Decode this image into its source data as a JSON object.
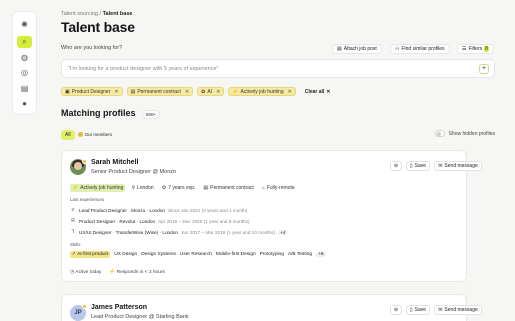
{
  "rail": {
    "items": [
      {
        "icon": "logo-icon",
        "glyph": "✺"
      },
      {
        "icon": "search-icon",
        "glyph": "⌕",
        "active": true
      },
      {
        "icon": "globe-icon",
        "glyph": "◍"
      },
      {
        "icon": "target-icon",
        "glyph": "◎"
      },
      {
        "icon": "document-icon",
        "glyph": "▤"
      },
      {
        "icon": "user-avatar-icon",
        "glyph": "●"
      }
    ]
  },
  "breadcrumb": {
    "parent": "Talent sourcing",
    "separator": "/",
    "current": "Talent base"
  },
  "page_title": "Talent base",
  "search": {
    "prompt": "Who are you looking for?",
    "placeholder": "\"I'm looking for a product designer with 5 years of experience\"",
    "add": "+"
  },
  "toolbar": {
    "attach": "Attach job post",
    "find_similar": "Find similar profiles",
    "filters": "Filters",
    "filters_count": "8"
  },
  "filters": [
    {
      "icon": "briefcase-icon",
      "glyph": "▣",
      "label": "Product Designer"
    },
    {
      "icon": "contract-icon",
      "glyph": "▤",
      "label": "Permanent contract"
    },
    {
      "icon": "brain-icon",
      "glyph": "✿",
      "label": "AI"
    },
    {
      "icon": "lightning-icon",
      "glyph": "⚡",
      "label": "Actively job hunting"
    }
  ],
  "clear_all": "Clear all",
  "matching": {
    "title": "Matching profiles",
    "count": "500+"
  },
  "segments": {
    "all": "All",
    "members": "Our members"
  },
  "hidden_toggle": "Show hidden profiles",
  "actions": {
    "save": "Save",
    "message": "Send message"
  },
  "profiles": [
    {
      "name": "Sarah Mitchell",
      "role": "Senior Product Designer @ Monzo",
      "tags": [
        {
          "icon": "lightning-icon",
          "glyph": "⚡",
          "label": "Actively job hunting"
        },
        {
          "icon": "location-icon",
          "glyph": "⚲",
          "label": "London"
        },
        {
          "icon": "experience-icon",
          "glyph": "⚙",
          "label": "7 years exp."
        },
        {
          "icon": "contract-icon",
          "glyph": "▤",
          "label": "Permanent contract"
        },
        {
          "icon": "remote-icon",
          "glyph": "⌂",
          "label": "Fully-remote"
        }
      ],
      "experience_label": "Last experiences",
      "experiences": [
        {
          "icon": "monzo-logo-icon",
          "glyph": "≡",
          "text": "Lead Product Designer · Monzo · London",
          "dates": "Since Jan 2021 (3 years and 1 month)"
        },
        {
          "icon": "revolut-logo-icon",
          "glyph": "R",
          "text": "Product Designer · Revolut · London",
          "dates": "Apr 2019 – Dec 2020 (1 year and 8 months)"
        },
        {
          "icon": "wise-logo-icon",
          "glyph": "⅂",
          "text": "UX/UI Designer · TransferWise (Wise) · London",
          "dates": "Jun 2017 – Mar 2019 (1 year and 10 months)",
          "more": "+4"
        }
      ],
      "skills_label": "Skills",
      "skills": [
        "AI-first product",
        "UX Design",
        "Design Systems",
        "User Research",
        "Mobile-first Design",
        "Prototyping",
        "A/B Testing"
      ],
      "skills_more": "+6",
      "activity": "Active today",
      "response": "Responds in < 3 hours"
    },
    {
      "name": "James Patterson",
      "role": "Lead Product Designer @ Starling Bank",
      "initials": "JP"
    }
  ]
}
